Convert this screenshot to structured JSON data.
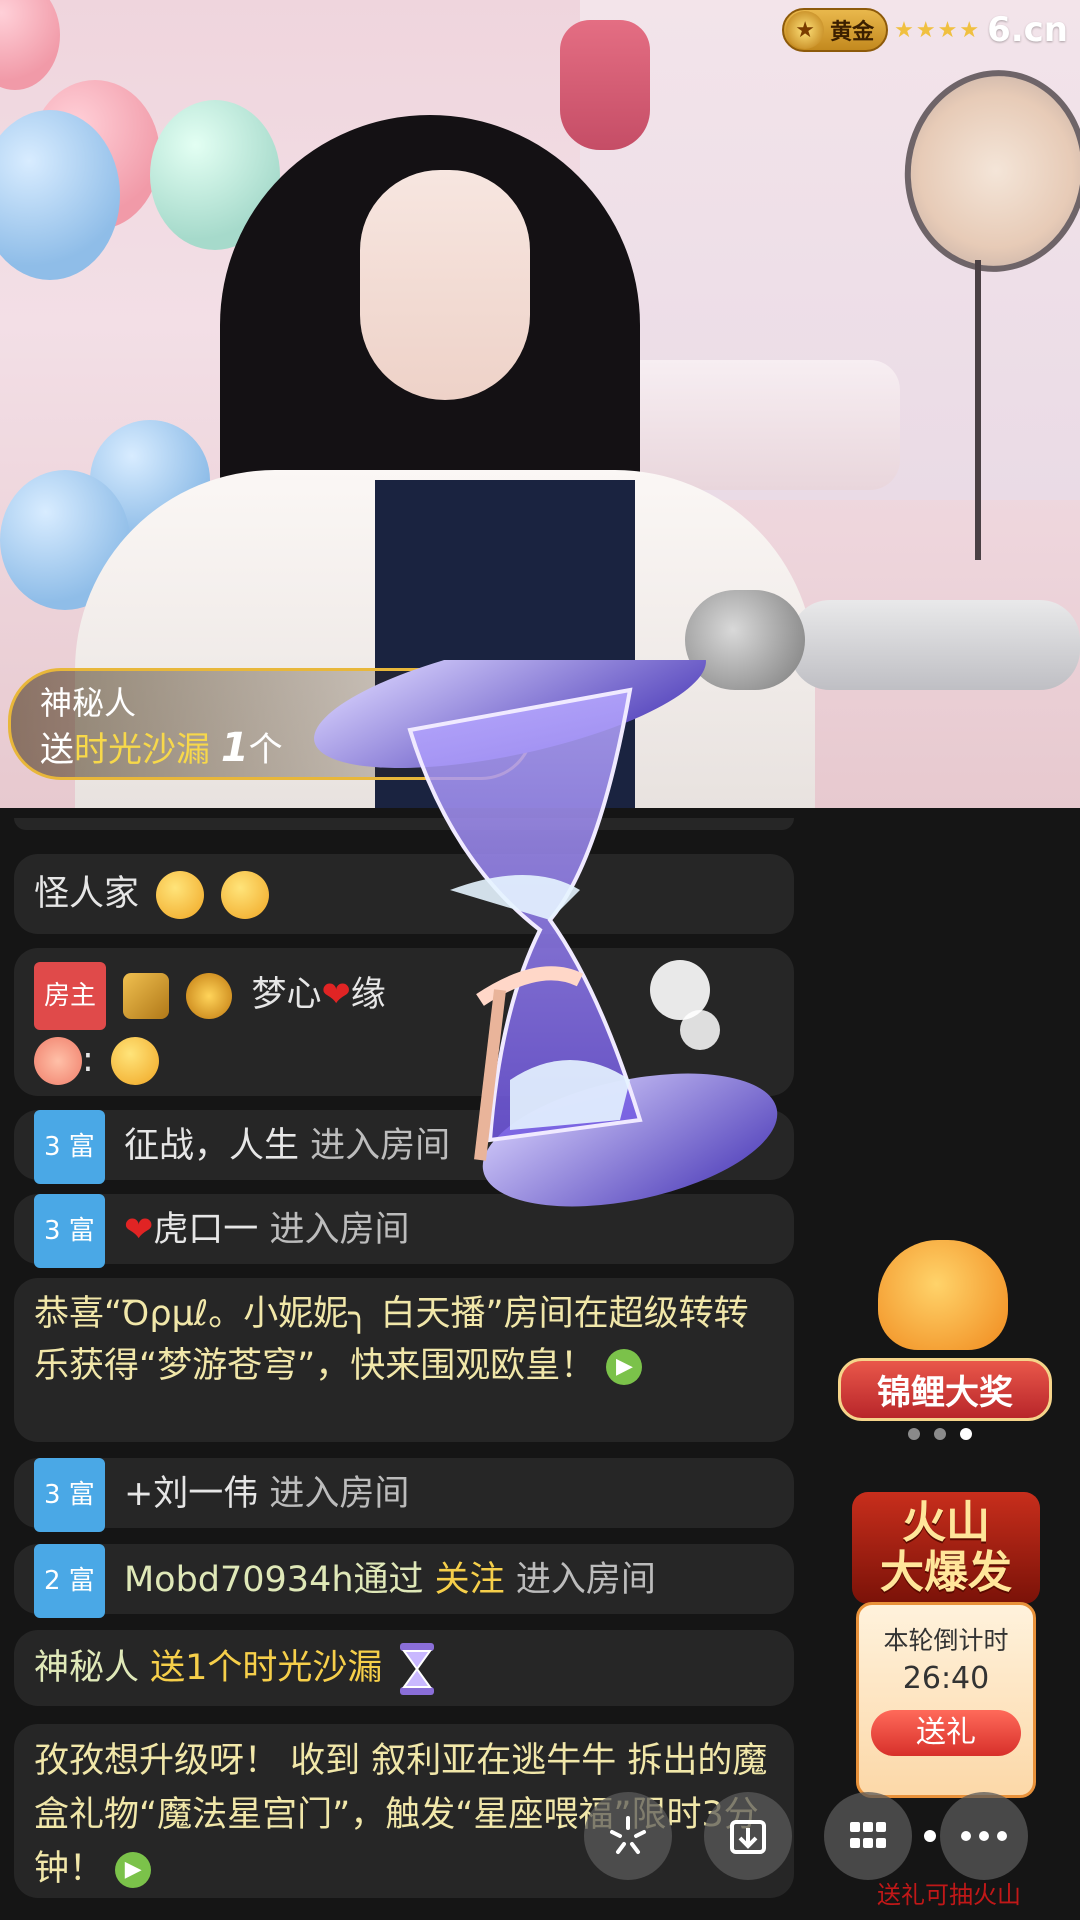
{
  "header": {
    "rank_label": "黄金",
    "stars": "★★★★",
    "site_logo": "6.cn"
  },
  "gift_banner": {
    "user": "神秘人",
    "prefix": "送",
    "gift_name": "时光沙漏",
    "count": "1",
    "unit": "个"
  },
  "chat": {
    "msg1": {
      "text": "怪人家"
    },
    "msg2": {
      "host_tag": "房主",
      "name": "梦心",
      "heart": "❤",
      "rest": "缘",
      "colon": ":"
    },
    "msg3": {
      "level": "3 富",
      "name": "征战，人生",
      "action": "进入房间"
    },
    "msg4": {
      "level": "3 富",
      "heart": "❤",
      "name": "虎口一",
      "action": "进入房间"
    },
    "msg5": {
      "text": "恭喜“Ꝺρμℓ。小妮妮╮ 白天播”房间在超级转转乐获得“梦游苍穹”，快来围观欧皇！"
    },
    "msg6": {
      "level": "3 富",
      "name": "+刘一伟",
      "action": "进入房间"
    },
    "msg7": {
      "level": "2 富",
      "name": "Mobd70934h通过",
      "via": "关注",
      "action": "进入房间"
    },
    "msg8": {
      "name": "神秘人",
      "gift": "送1个时光沙漏"
    },
    "msg9": {
      "text": "孜孜想升级呀！ 收到 叙利亚在逃牛牛 拆出的魔盒礼物“魔法星宫门”，触发“星座喂福”限时3分钟！"
    }
  },
  "promos": {
    "koi_label": "锦鲤大奖",
    "volcano_title_1": "火山",
    "volcano_title_2": "大爆发",
    "countdown_label": "本轮倒计时",
    "countdown": "26:40",
    "send_button": "送礼",
    "footer": "送礼可抽火山"
  },
  "toolbar": {
    "icons": [
      "sparkle-icon",
      "download-icon",
      "grid-icon",
      "more-icon"
    ]
  }
}
